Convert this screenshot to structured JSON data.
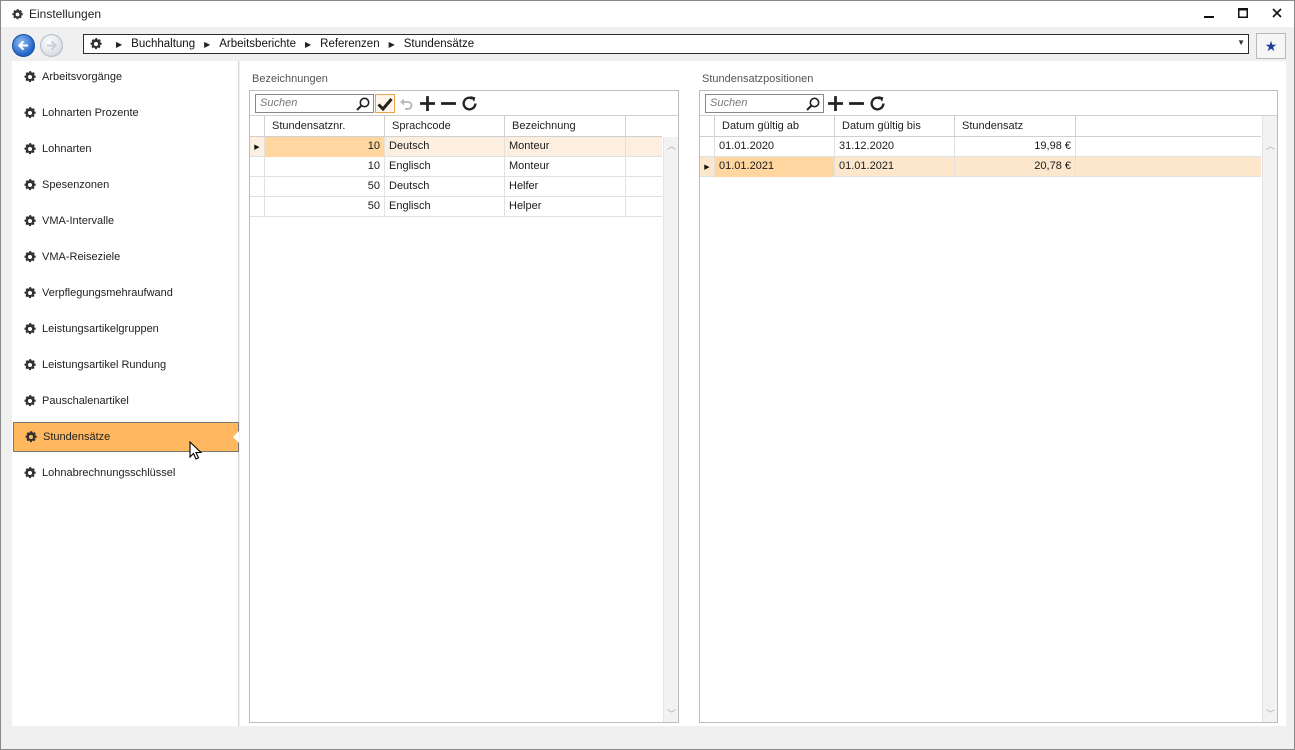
{
  "window": {
    "title": "Einstellungen",
    "icon": "gear-icon",
    "buttons": {
      "minimize": "—",
      "maximize": "☐",
      "close": "✕"
    }
  },
  "navigation": {
    "back_icon": "arrow-left-icon",
    "forward_icon": "arrow-right-icon",
    "breadcrumbs": [
      "Buchhaltung",
      "Arbeitsberichte",
      "Referenzen",
      "Stundensätze"
    ],
    "favorite_icon": "star-icon"
  },
  "sidebar": {
    "items": [
      {
        "label": "Arbeitsvorgänge",
        "active": false
      },
      {
        "label": "Lohnarten Prozente",
        "active": false
      },
      {
        "label": "Lohnarten",
        "active": false
      },
      {
        "label": "Spesenzonen",
        "active": false
      },
      {
        "label": "VMA-Intervalle",
        "active": false
      },
      {
        "label": "VMA-Reiseziele",
        "active": false
      },
      {
        "label": "Verpflegungsmehraufwand",
        "active": false
      },
      {
        "label": "Leistungsartikelgruppen",
        "active": false
      },
      {
        "label": "Leistungsartikel Rundung",
        "active": false
      },
      {
        "label": "Pauschalenartikel",
        "active": false
      },
      {
        "label": "Stundensätze",
        "active": true
      },
      {
        "label": "Lohnabrechnungsschlüssel",
        "active": false
      }
    ]
  },
  "left_panel": {
    "title": "Bezeichnungen",
    "search_placeholder": "Suchen",
    "columns": [
      "Stundensatznr.",
      "Sprachcode",
      "Bezeichnung"
    ],
    "rows": [
      {
        "nr": "10",
        "lang": "Deutsch",
        "name": "Monteur"
      },
      {
        "nr": "10",
        "lang": "Englisch",
        "name": "Monteur"
      },
      {
        "nr": "50",
        "lang": "Deutsch",
        "name": "Helfer"
      },
      {
        "nr": "50",
        "lang": "Englisch",
        "name": "Helper"
      }
    ]
  },
  "right_panel": {
    "title": "Stundensatzpositionen",
    "search_placeholder": "Suchen",
    "columns": [
      "Datum gültig ab",
      "Datum gültig bis",
      "Stundensatz"
    ],
    "rows": [
      {
        "from": "01.01.2020",
        "to": "31.12.2020",
        "rate": "19,98 €"
      },
      {
        "from": "01.01.2021",
        "to": "01.01.2021",
        "rate": "20,78 €"
      }
    ]
  },
  "colors": {
    "accent_active": "#ffb860",
    "selected_row": "#fdefe0",
    "focus_cell": "#ffd6a0"
  }
}
